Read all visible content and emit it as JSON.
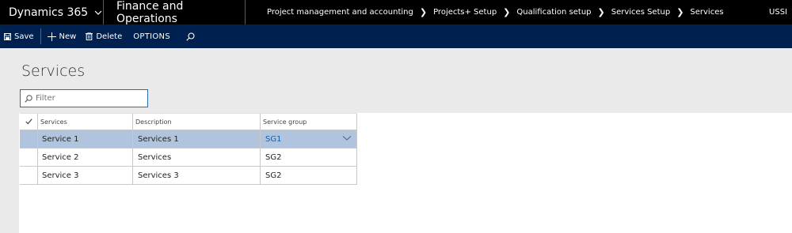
{
  "topbar": {
    "app_name": "Dynamics 365",
    "module": "Finance and Operations",
    "breadcrumb": [
      "Project management and accounting",
      "Projects+ Setup",
      "Qualification setup",
      "Services Setup",
      "Services"
    ],
    "company": "USSI"
  },
  "actions": {
    "save": "Save",
    "new": "New",
    "delete": "Delete",
    "options": "OPTIONS"
  },
  "page": {
    "title": "Services",
    "filter_placeholder": "Filter"
  },
  "grid": {
    "columns": [
      "Services",
      "Description",
      "Service group"
    ],
    "rows": [
      {
        "service": "Service 1",
        "description": "Services 1",
        "group": "SG1",
        "selected": true
      },
      {
        "service": "Service 2",
        "description": "Services",
        "group": "SG2",
        "selected": false
      },
      {
        "service": "Service 3",
        "description": "Services 3",
        "group": "SG2",
        "selected": false
      }
    ]
  },
  "colors": {
    "topbar_bg": "#000000",
    "actionbar_bg": "#002050",
    "selected_row_bg": "#b0c4de",
    "accent": "#2b6dad"
  },
  "icons": [
    "chevron-down-icon",
    "save-icon",
    "plus-icon",
    "trash-icon",
    "search-icon",
    "checkmark-icon"
  ]
}
